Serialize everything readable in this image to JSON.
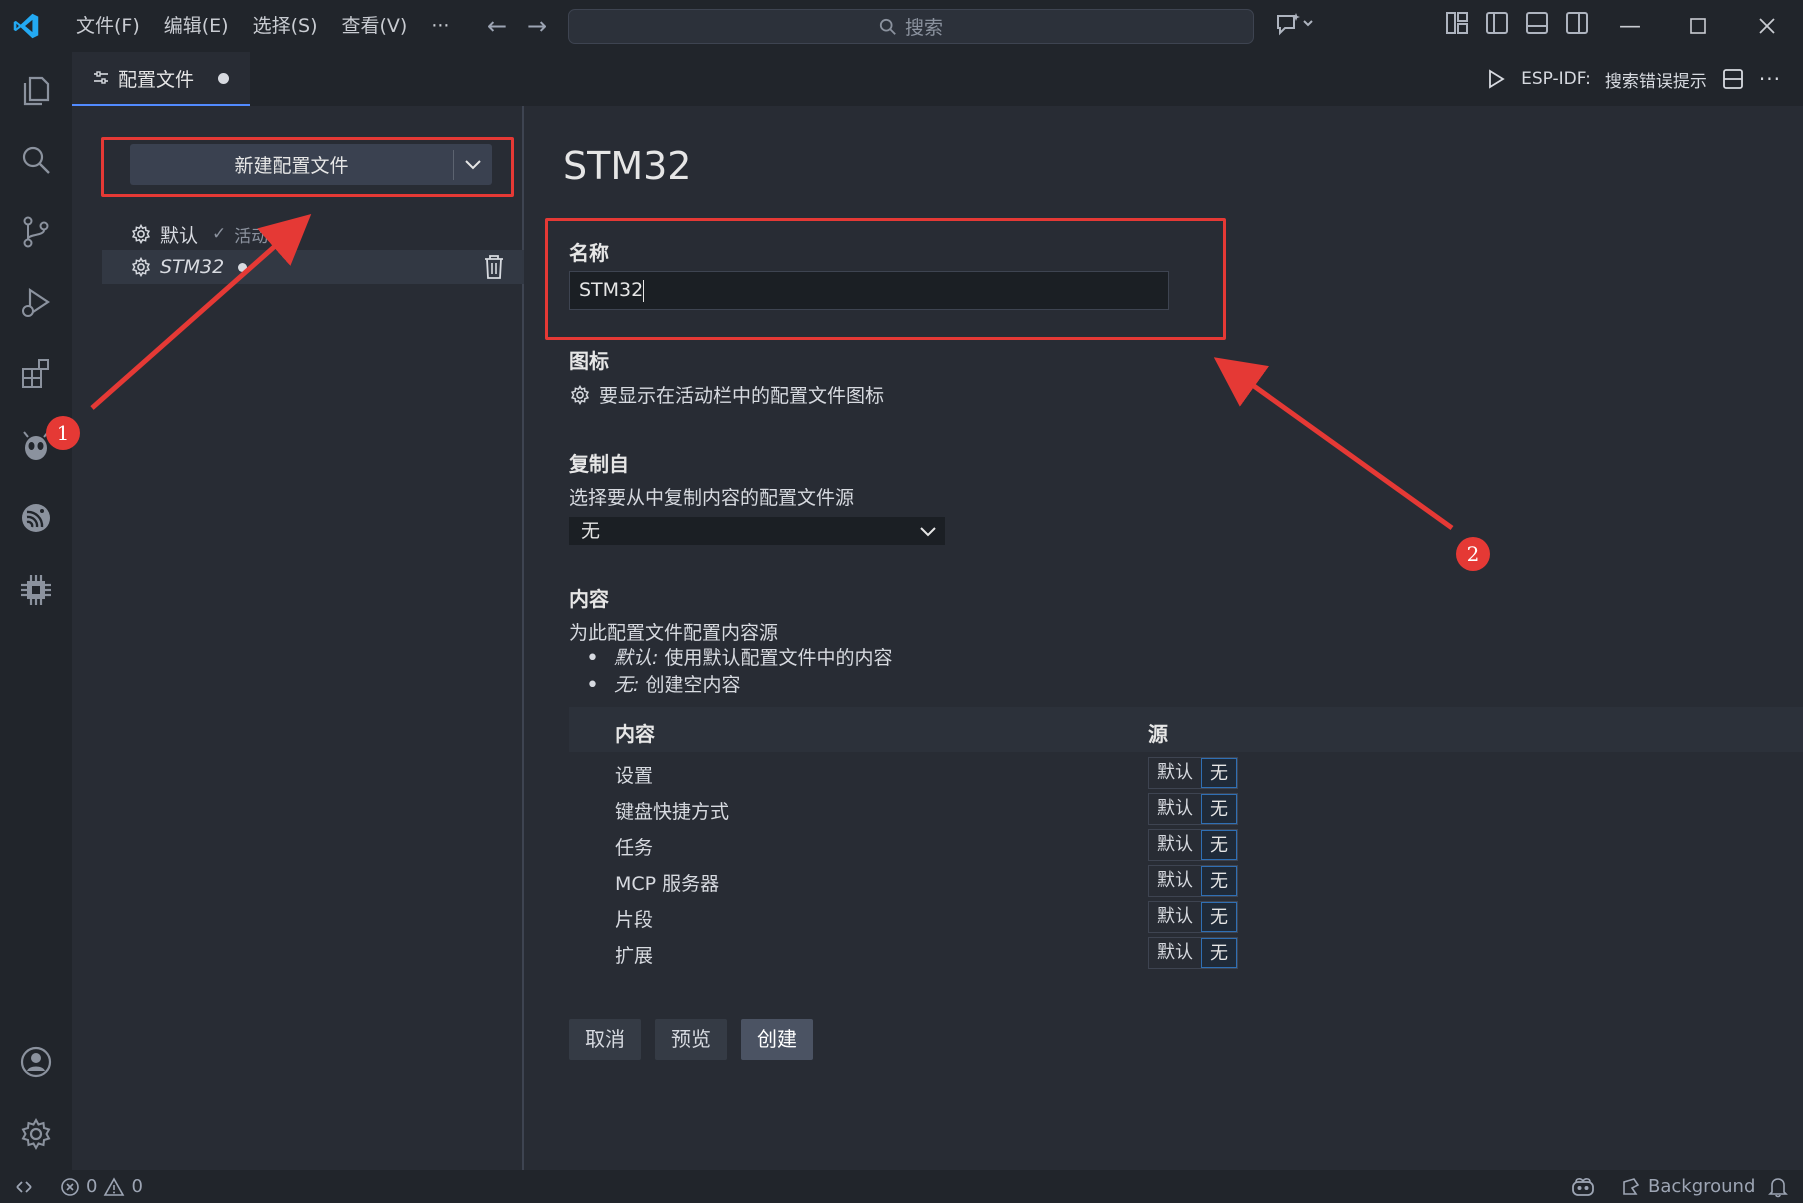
{
  "titlebar": {
    "menu": [
      "文件(F)",
      "编辑(E)",
      "选择(S)",
      "查看(V)",
      "···"
    ],
    "search_placeholder": "搜索"
  },
  "tab": {
    "label": "配置文件"
  },
  "tab_actions": {
    "esp_label": "ESP-IDF:",
    "esp_action": "搜索错误提示"
  },
  "left_pane": {
    "new_button": "新建配置文件",
    "profiles": [
      {
        "name": "默认",
        "status": "活动"
      },
      {
        "name": "STM32"
      }
    ]
  },
  "editor": {
    "title": "STM32",
    "name_label": "名称",
    "name_value": "STM32",
    "icon_label": "图标",
    "icon_desc": "要显示在活动栏中的配置文件图标",
    "copy_label": "复制自",
    "copy_desc": "选择要从中复制内容的配置文件源",
    "copy_value": "无",
    "content_label": "内容",
    "content_desc": "为此配置文件配置内容源",
    "bullets": [
      {
        "term": "默认:",
        "text": " 使用默认配置文件中的内容"
      },
      {
        "term": "无:",
        "text": " 创建空内容"
      }
    ],
    "table": {
      "col_content": "内容",
      "col_source": "源",
      "option_default": "默认",
      "option_none": "无",
      "rows": [
        "设置",
        "键盘快捷方式",
        "任务",
        "MCP 服务器",
        "片段",
        "扩展"
      ]
    },
    "buttons": {
      "cancel": "取消",
      "preview": "预览",
      "create": "创建"
    }
  },
  "annotations": [
    "1",
    "2"
  ],
  "statusbar": {
    "errors": "0",
    "warnings": "0",
    "background": "Background"
  },
  "colors": {
    "annotation_red": "#e53935",
    "accent_blue": "#2f6fb4",
    "vscode_blue": "#23a9f2"
  }
}
